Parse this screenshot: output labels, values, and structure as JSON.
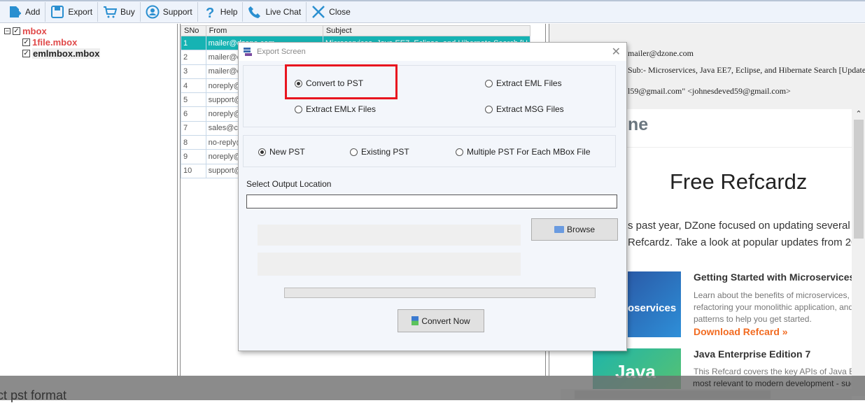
{
  "toolbar": {
    "items": [
      {
        "label": "Add",
        "icon": "add-file-icon"
      },
      {
        "label": "Export",
        "icon": "save-icon"
      },
      {
        "label": "Buy",
        "icon": "cart-icon"
      },
      {
        "label": "Support",
        "icon": "support-icon"
      },
      {
        "label": "Help",
        "icon": "help-icon"
      },
      {
        "label": "Live Chat",
        "icon": "phone-icon"
      },
      {
        "label": "Close",
        "icon": "close-icon"
      }
    ]
  },
  "tree": {
    "root": "mbox",
    "children": [
      "1file.mbox",
      "emlmbox.mbox"
    ]
  },
  "list": {
    "columns": [
      "SNo",
      "From",
      "Subject"
    ],
    "rows": [
      {
        "sno": "1",
        "from": "mailer@dzone.com",
        "subject": "Microservices, Java EE7, Eclipse, and Hibernate Search [U"
      },
      {
        "sno": "2",
        "from": "mailer@d",
        "subject": ""
      },
      {
        "sno": "3",
        "from": "mailer@d",
        "subject": ""
      },
      {
        "sno": "4",
        "from": "noreply@",
        "subject": ""
      },
      {
        "sno": "5",
        "from": "support@",
        "subject": ""
      },
      {
        "sno": "6",
        "from": "noreply@",
        "subject": ""
      },
      {
        "sno": "7",
        "from": "sales@cit",
        "subject": ""
      },
      {
        "sno": "8",
        "from": "no-reply@",
        "subject": ""
      },
      {
        "sno": "9",
        "from": "noreply@",
        "subject": ""
      },
      {
        "sno": "10",
        "from": "support@",
        "subject": ""
      }
    ]
  },
  "preview": {
    "from": "mailer@dzone.com",
    "subject": "Sub:- Microservices, Java EE7, Eclipse, and Hibernate Search [Update",
    "to": "l59@gmail.com\" <johnesdeved59@gmail.com>",
    "logo": "ne",
    "heading": "Free Refcardz",
    "intro1": "s past year, DZone focused on updating several",
    "intro2": "Refcardz. Take a look at popular updates from 20",
    "card1": {
      "title": "Getting Started with Microservices",
      "desc1": "Learn about the benefits of microservices,",
      "desc2": "refactoring your monolithic application, and",
      "desc3": "patterns to help you get started.",
      "link": "Download Refcard »",
      "thumb": "oservices"
    },
    "card2": {
      "title": "Java Enterprise Edition 7",
      "desc1": "This Refcard covers the key APIs of Java EE",
      "desc2": "most relevant to modern development - suc",
      "thumb": "Java"
    }
  },
  "dialog": {
    "title": "Export Screen",
    "formats": [
      "Convert to PST",
      "Extract EML Files",
      "Extract EMLx Files",
      "Extract MSG Files"
    ],
    "selected_format": "Convert to PST",
    "pst_options": [
      "New PST",
      "Existing PST",
      "Multiple PST For Each MBox File"
    ],
    "selected_pst": "New PST",
    "output_label": "Select Output Location",
    "output_value": "",
    "browse": "Browse",
    "convert": "Convert Now",
    "progress_percent": 0,
    "highlight_color": "#e8151f"
  },
  "overlay_text": "ct pst format"
}
